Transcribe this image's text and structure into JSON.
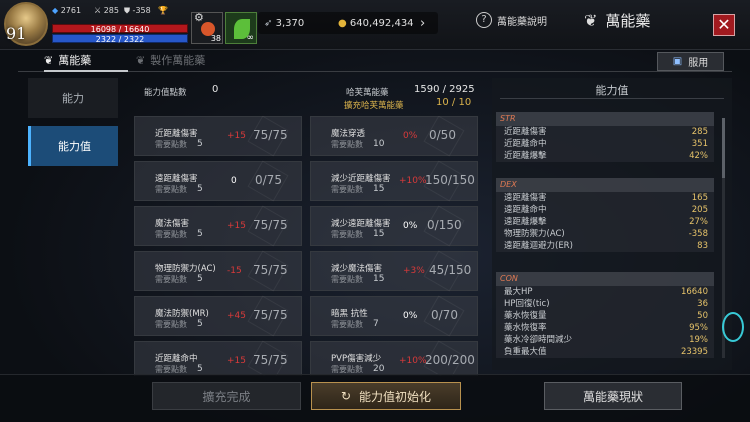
{
  "player": {
    "level": "91",
    "stat1": "2761",
    "stat2": "285",
    "stat3": "358",
    "hp_text": "16098 / 16640",
    "mp_text": "2322 / 2322",
    "hp_fraction": 0.967,
    "slot_count": "38"
  },
  "currency": {
    "gems": "3,370",
    "gold": "640,492,434"
  },
  "header": {
    "help_label": "萬能藥說明",
    "title": "萬能藥",
    "close_label": "✕"
  },
  "tabs": {
    "tab1": "萬能藥",
    "tab2": "製作萬能藥",
    "use_label": "服用"
  },
  "side": {
    "items": [
      {
        "label": "能力"
      },
      {
        "label": "能力值"
      }
    ]
  },
  "summary": {
    "points_label": "能力值點數",
    "points_value": "0",
    "range_label": "哈芙萬能藥",
    "range_value": "1590 / 2925",
    "expand_label": "擴充哈芙萬能藥",
    "expand_value": "10 / 10"
  },
  "cards": [
    {
      "name": "近距離傷害",
      "req_label": "需要點數",
      "req": "5",
      "bonus": "+15",
      "count": "75/75"
    },
    {
      "name": "魔法穿透",
      "req_label": "需要點數",
      "req": "10",
      "bonus": "0%",
      "count": "0/50"
    },
    {
      "name": "遠距離傷害",
      "req_label": "需要點數",
      "req": "5",
      "bonus": "0",
      "count": "0/75"
    },
    {
      "name": "減少近距離傷害",
      "req_label": "需要點數",
      "req": "15",
      "bonus": "+10%",
      "count": "150/150"
    },
    {
      "name": "魔法傷害",
      "req_label": "需要點數",
      "req": "5",
      "bonus": "+15",
      "count": "75/75"
    },
    {
      "name": "減少遠距離傷害",
      "req_label": "需要點數",
      "req": "15",
      "bonus": "0%",
      "count": "0/150"
    },
    {
      "name": "物理防禦力(AC)",
      "req_label": "需要點數",
      "req": "5",
      "bonus": "-15",
      "count": "75/75"
    },
    {
      "name": "減少魔法傷害",
      "req_label": "需要點數",
      "req": "15",
      "bonus": "+3%",
      "count": "45/150"
    },
    {
      "name": "魔法防禦(MR)",
      "req_label": "需要點數",
      "req": "5",
      "bonus": "+45",
      "count": "75/75"
    },
    {
      "name": "暗黑 抗性",
      "req_label": "需要點數",
      "req": "7",
      "bonus": "0%",
      "count": "0/70"
    },
    {
      "name": "近距離命中",
      "req_label": "需要點數",
      "req": "5",
      "bonus": "+15",
      "count": "75/75"
    },
    {
      "name": "PVP傷害減少",
      "req_label": "需要點數",
      "req": "20",
      "bonus": "+10%",
      "count": "200/200"
    }
  ],
  "panel": {
    "title": "能力值",
    "sections": [
      {
        "name": "STR",
        "rows": [
          {
            "label": "近距離傷害",
            "value": "285"
          },
          {
            "label": "近距離命中",
            "value": "351"
          },
          {
            "label": "近距離爆擊",
            "value": "42%"
          }
        ]
      },
      {
        "name": "DEX",
        "rows": [
          {
            "label": "遠距離傷害",
            "value": "165"
          },
          {
            "label": "遠距離命中",
            "value": "205"
          },
          {
            "label": "遠距離爆擊",
            "value": "27%"
          },
          {
            "label": "物理防禦力(AC)",
            "value": "-358"
          },
          {
            "label": "遠距離迴避力(ER)",
            "value": "83"
          }
        ]
      },
      {
        "name": "CON",
        "rows": [
          {
            "label": "最大HP",
            "value": "16640"
          },
          {
            "label": "HP回復(tic)",
            "value": "36"
          },
          {
            "label": "藥水恢復量",
            "value": "50"
          },
          {
            "label": "藥水恢復率",
            "value": "95%"
          },
          {
            "label": "藥水冷卻時間減少",
            "value": "19%"
          },
          {
            "label": "負重最大值",
            "value": "23395"
          }
        ]
      }
    ]
  },
  "buttons": {
    "expand_done": "擴充完成",
    "reset": "能力值初始化",
    "status": "萬能藥現狀"
  },
  "colors": {
    "accent_gold": "#d9b24c",
    "bonus_red": "#d83a3a",
    "active_blue": "#1c4c78",
    "close_red": "#a11a1f"
  }
}
